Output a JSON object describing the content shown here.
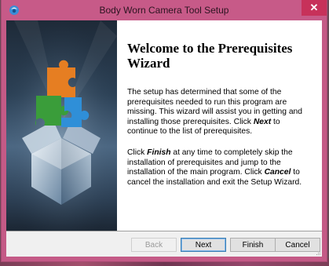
{
  "window": {
    "title": "Body Worn Camera Tool Setup",
    "close_glyph": "✕"
  },
  "content": {
    "heading": "Welcome to the Prerequisites Wizard",
    "para1_a": "The setup has determined that some of the prerequisites needed to run this program are missing. This wizard will assist you in getting and installing those prerequisites. Click ",
    "para1_bold": "Next",
    "para1_b": "  to continue to the list of prerequisites.",
    "para2_a": "Click ",
    "para2_bold1": "Finish",
    "para2_b": " at any time to completely skip the installation of prerequisites and jump to the installation of the main program. Click ",
    "para2_bold2": "Cancel",
    "para2_c": " to cancel the installation and exit the Setup Wizard."
  },
  "buttons": {
    "back": "Back",
    "next": "Next",
    "finish": "Finish",
    "cancel": "Cancel"
  },
  "icons": {
    "app": "setup-app-icon",
    "close": "close-icon",
    "hero": "puzzle-box-illustration",
    "grip": "resize-grip-icon"
  },
  "colors": {
    "titlebar": "#c75a88",
    "close_button": "#c7315a",
    "default_button_border": "#3c7fb1"
  }
}
